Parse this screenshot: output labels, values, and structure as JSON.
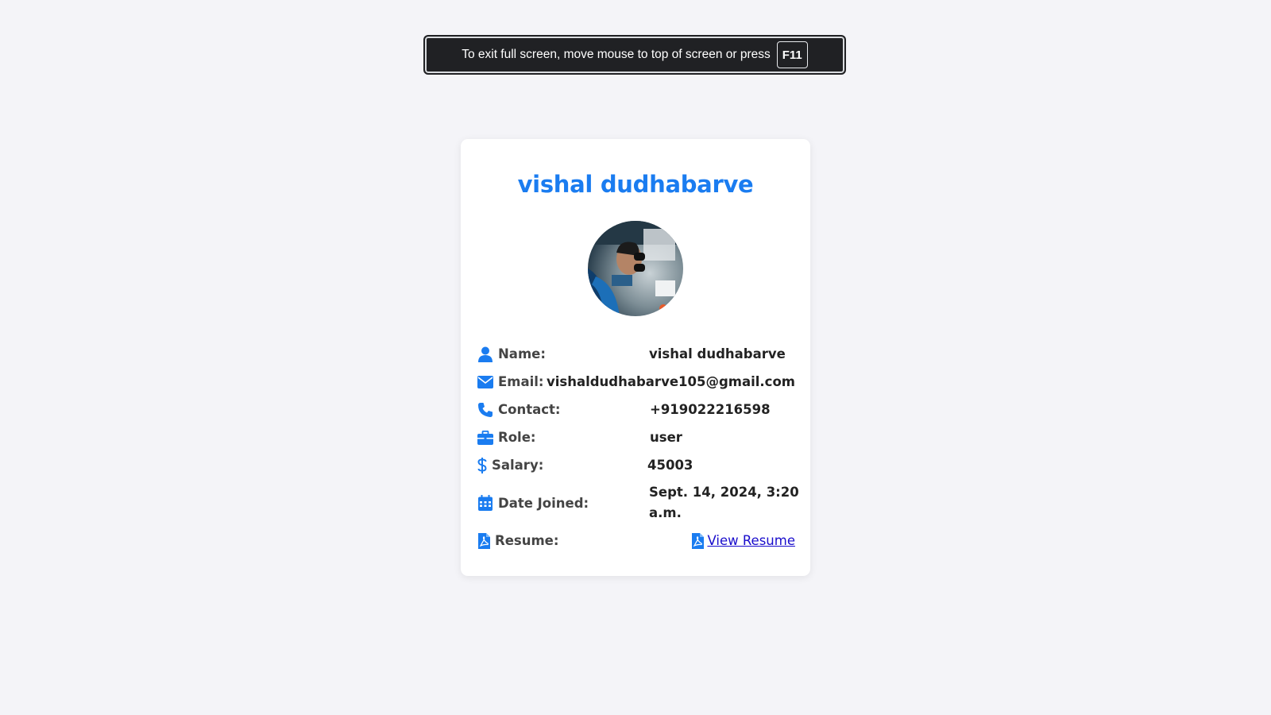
{
  "fullscreen_banner": {
    "message": "To exit full screen, move mouse to top of screen or press",
    "key": "F11"
  },
  "profile": {
    "title": "vishal dudhabarve",
    "avatar_icon": "profile-photo",
    "accent_color": "#1a7cf0",
    "fields": {
      "name": {
        "label": "Name:",
        "value": "vishal dudhabarve",
        "icon": "user-icon"
      },
      "email": {
        "label": "Email:",
        "value": "vishaldudhabarve105@gmail.com",
        "icon": "envelope-icon"
      },
      "contact": {
        "label": "Contact:",
        "value": "+919022216598",
        "icon": "phone-icon"
      },
      "role": {
        "label": "Role:",
        "value": "user",
        "icon": "briefcase-icon"
      },
      "salary": {
        "label": "Salary:",
        "value": "45003",
        "icon": "dollar-icon"
      },
      "date_joined": {
        "label": "Date Joined:",
        "value": "Sept. 14, 2024, 3:20 a.m.",
        "icon": "calendar-icon"
      },
      "resume": {
        "label": "Resume:",
        "link_text": "View Resume",
        "icon": "pdf-file-icon"
      }
    }
  }
}
